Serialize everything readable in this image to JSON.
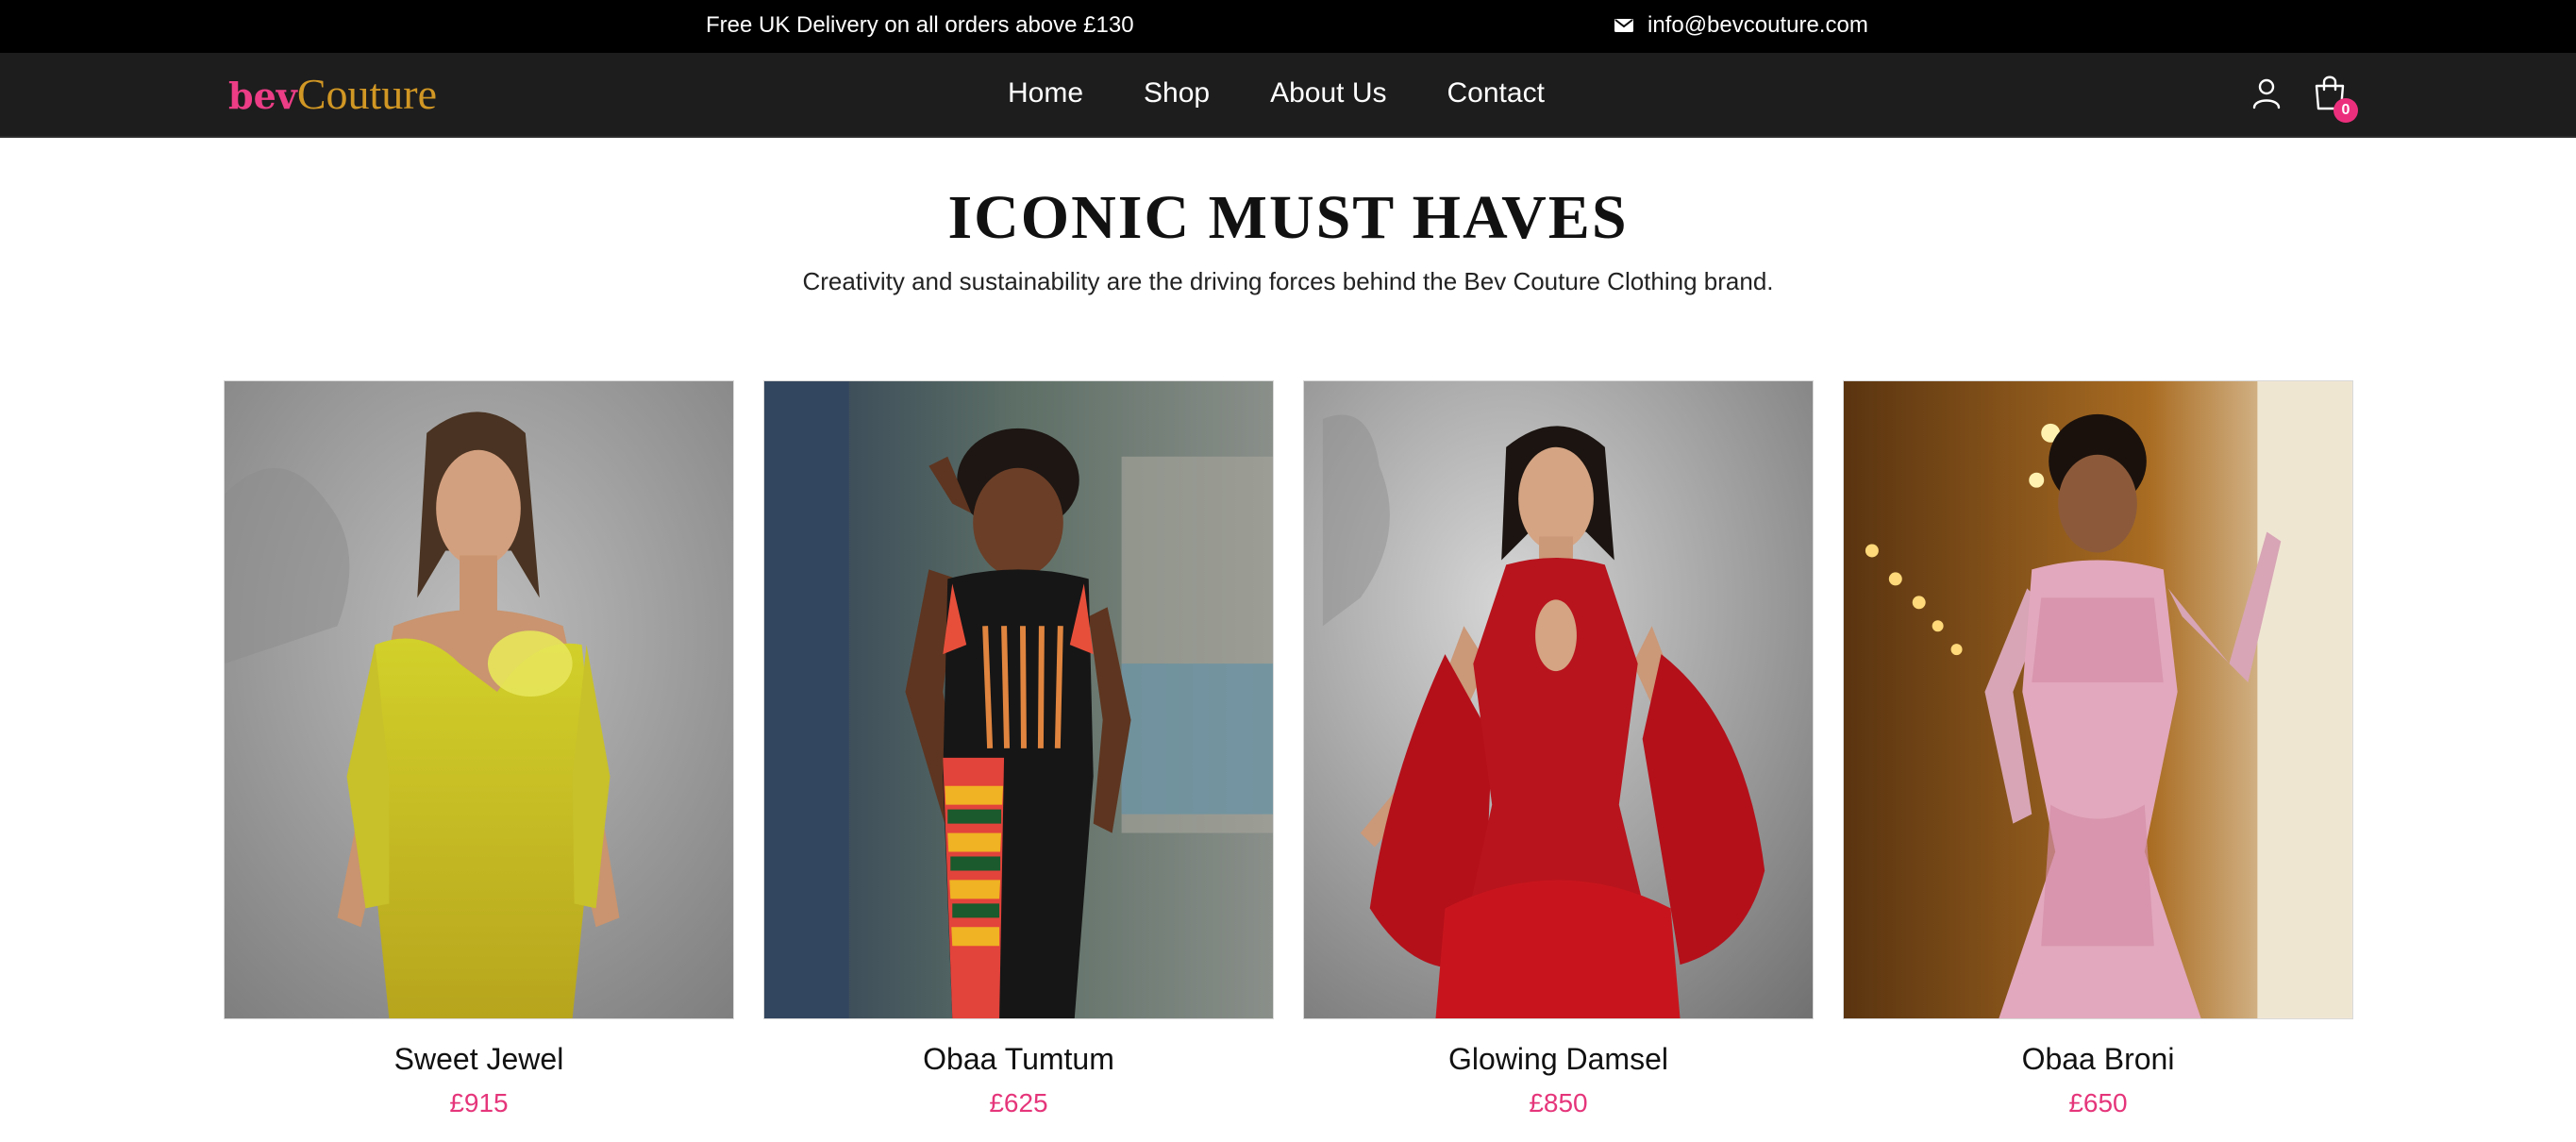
{
  "topbar": {
    "promo": "Free UK Delivery on all orders above £130",
    "email": "info@bevcouture.com",
    "email_icon": "mail-icon"
  },
  "nav": {
    "logo_part1": "bev",
    "logo_part2": "Couture",
    "items": [
      {
        "label": "Home"
      },
      {
        "label": "Shop"
      },
      {
        "label": "About Us"
      },
      {
        "label": "Contact"
      }
    ],
    "account_icon": "user-icon",
    "cart_icon": "shopping-bag-icon",
    "cart_count": "0"
  },
  "section": {
    "title": "ICONIC MUST HAVES",
    "subtitle": "Creativity and sustainability are the driving forces behind the Bev Couture Clothing brand."
  },
  "products": [
    {
      "name": "Sweet Jewel",
      "price": "£915"
    },
    {
      "name": "Obaa Tumtum",
      "price": "£625"
    },
    {
      "name": "Glowing Damsel",
      "price": "£850"
    },
    {
      "name": "Obaa Broni",
      "price": "£650"
    }
  ],
  "colors": {
    "brand_pink": "#ec3d86",
    "brand_gold": "#d19724",
    "price_pink": "#e5357a",
    "topbar_bg": "#000000",
    "nav_bg": "#1d1d1d"
  }
}
